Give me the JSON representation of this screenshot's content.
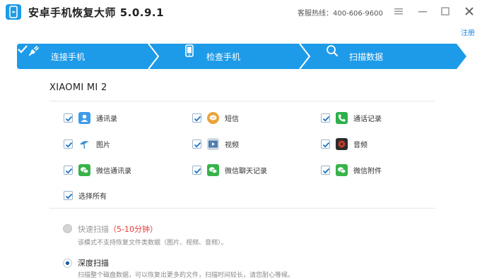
{
  "window": {
    "title": "安卓手机恢复大师 5.0.9.1",
    "hotline": "客服热线：400-606-9600",
    "register": "注册"
  },
  "steps": [
    {
      "label": "连接手机",
      "icon": "plug-icon",
      "done": true
    },
    {
      "label": "检查手机",
      "icon": "phone-icon",
      "done": true
    },
    {
      "label": "扫描数据",
      "icon": "search-icon",
      "done": false
    }
  ],
  "device": {
    "name": "XIAOMI MI 2"
  },
  "categories": [
    {
      "label": "通讯录",
      "icon": "contacts-icon",
      "checked": true
    },
    {
      "label": "短信",
      "icon": "sms-icon",
      "checked": true
    },
    {
      "label": "通话记录",
      "icon": "call-log-icon",
      "checked": true
    },
    {
      "label": "图片",
      "icon": "picture-icon",
      "checked": true
    },
    {
      "label": "视频",
      "icon": "video-icon",
      "checked": true
    },
    {
      "label": "音频",
      "icon": "audio-icon",
      "checked": true
    },
    {
      "label": "微信通讯录",
      "icon": "wechat-icon",
      "checked": true
    },
    {
      "label": "微信聊天记录",
      "icon": "wechat-icon",
      "checked": true
    },
    {
      "label": "微信附件",
      "icon": "wechat-icon",
      "checked": true
    }
  ],
  "select_all": {
    "label": "选择所有",
    "checked": true
  },
  "scan_modes": {
    "quick": {
      "title": "快速扫描",
      "duration": "（5-10分钟）",
      "desc": "该模式不支持恢复文件类数据（图片、视频、音频）。",
      "selected": false
    },
    "deep": {
      "title": "深度扫描",
      "desc": "扫描整个磁盘数据，可以恢复出更多的文件，扫描时间较长，请您耐心等候。",
      "selected": true
    }
  },
  "colors": {
    "accent": "#1e9be8",
    "check": "#1a73c8",
    "duration": "#e53935"
  }
}
